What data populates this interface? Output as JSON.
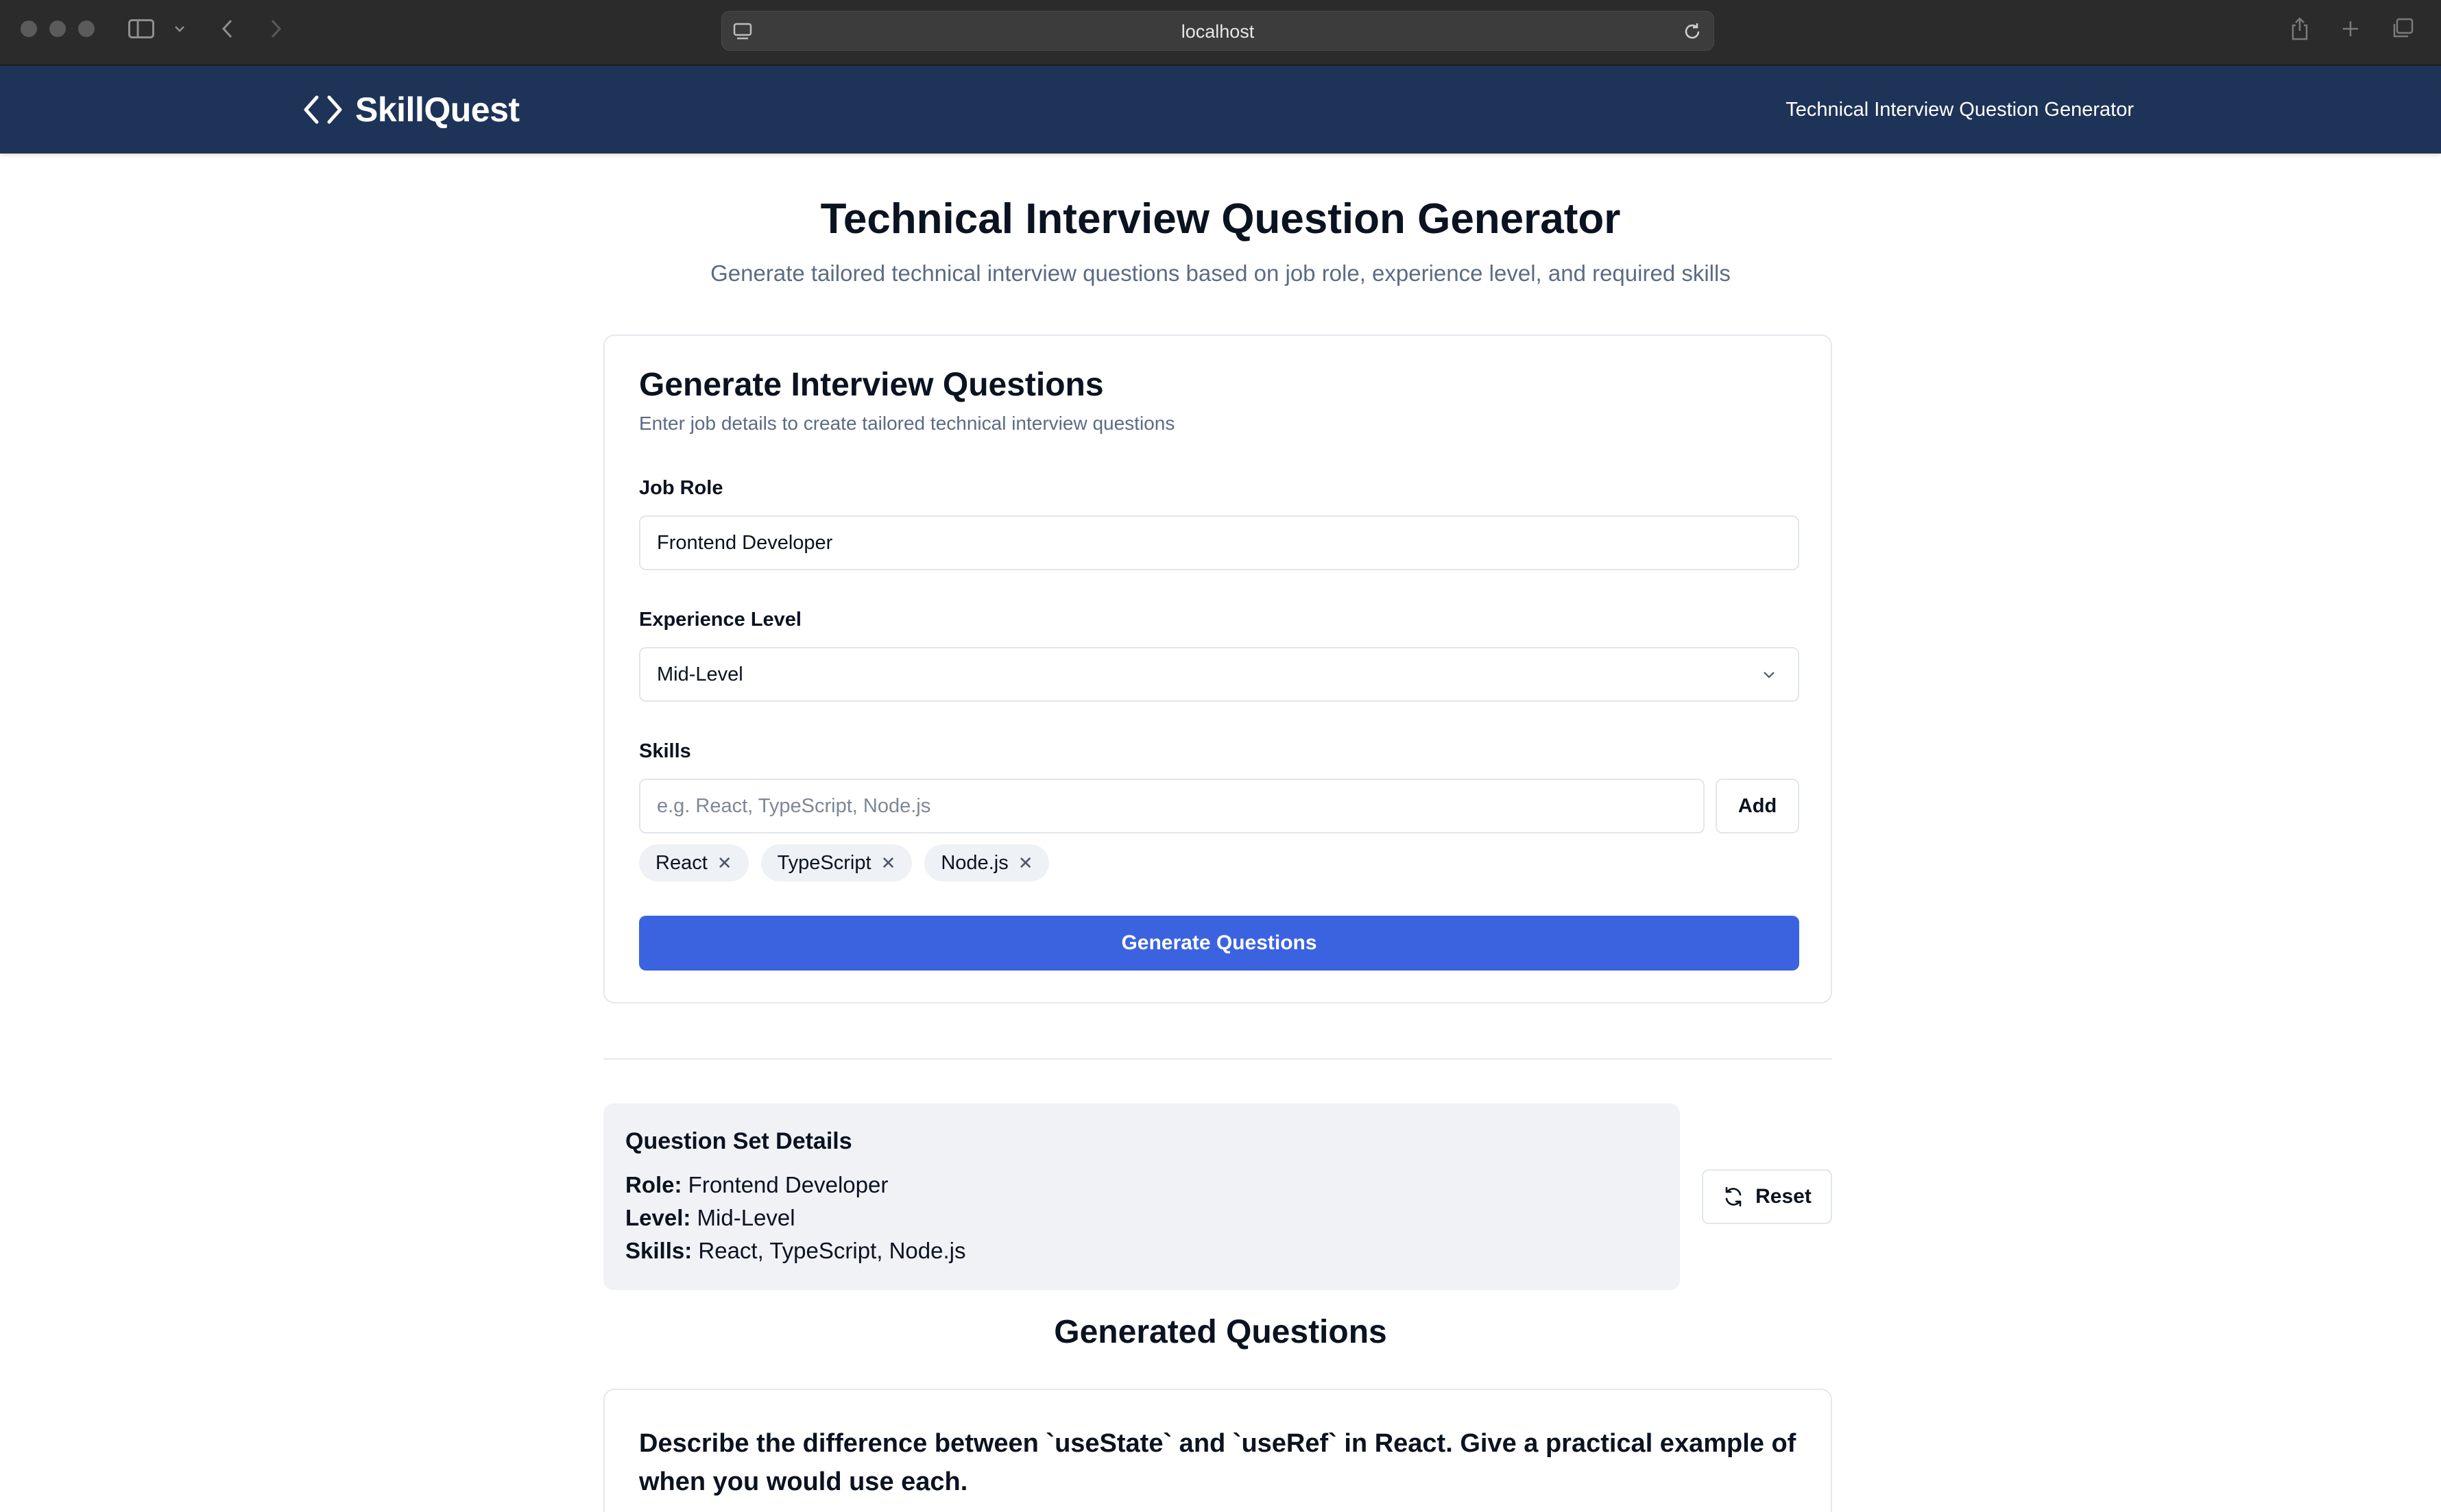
{
  "browser": {
    "url": "localhost"
  },
  "header": {
    "logo_text": "SkillQuest",
    "nav_link": "Technical Interview Question Generator"
  },
  "page": {
    "title": "Technical Interview Question Generator",
    "subtitle": "Generate tailored technical interview questions based on job role, experience level, and required skills"
  },
  "form": {
    "title": "Generate Interview Questions",
    "description": "Enter job details to create tailored technical interview questions",
    "job_role_label": "Job Role",
    "job_role_value": "Frontend Developer",
    "experience_label": "Experience Level",
    "experience_value": "Mid-Level",
    "skills_label": "Skills",
    "skills_placeholder": "e.g. React, TypeScript, Node.js",
    "add_label": "Add",
    "skills": [
      "React",
      "TypeScript",
      "Node.js"
    ],
    "submit_label": "Generate Questions"
  },
  "details": {
    "title": "Question Set Details",
    "role_key": "Role:",
    "role_value": "Frontend Developer",
    "level_key": "Level:",
    "level_value": "Mid-Level",
    "skills_key": "Skills:",
    "skills_value": "React, TypeScript, Node.js",
    "reset_label": "Reset"
  },
  "results": {
    "heading": "Generated Questions",
    "questions": [
      "Describe the difference between `useState` and `useRef` in React. Give a practical example of when you would use each."
    ]
  },
  "colors": {
    "header_bg": "#1e3358",
    "primary_button": "#3b63e0",
    "details_bg": "#f0f2f6"
  }
}
